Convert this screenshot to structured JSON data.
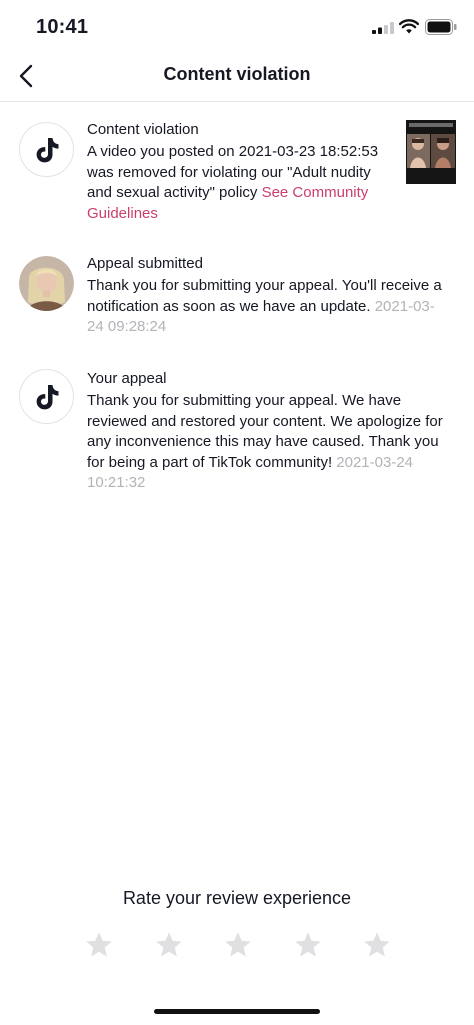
{
  "status_bar": {
    "time": "10:41"
  },
  "nav": {
    "title": "Content violation"
  },
  "notifications": [
    {
      "title": "Content violation",
      "text": "A video you posted on 2021-03-23 18:52:53 was removed for violating our \"Adult nudity and sexual activity\" policy ",
      "link": "See Community Guidelines",
      "icon": "tiktok-logo-icon"
    },
    {
      "title": "Appeal submitted",
      "text": "Thank you for submitting your appeal. You'll receive a notification as soon as we have an update. ",
      "timestamp": "2021-03-24 09:28:24",
      "icon": "user-avatar"
    },
    {
      "title": "Your appeal",
      "text": "Thank you for submitting your appeal. We have reviewed and restored your content. We apologize for any inconvenience this may have caused. Thank you for being a part of TikTok community! ",
      "timestamp": "2021-03-24 10:21:32",
      "icon": "tiktok-logo-icon"
    }
  ],
  "rating": {
    "title": "Rate your review experience",
    "star_count": 5,
    "selected": 0
  },
  "colors": {
    "link": "#cc3f6a",
    "timestamp": "#b3b3b8",
    "star": "#e0e0e3"
  }
}
